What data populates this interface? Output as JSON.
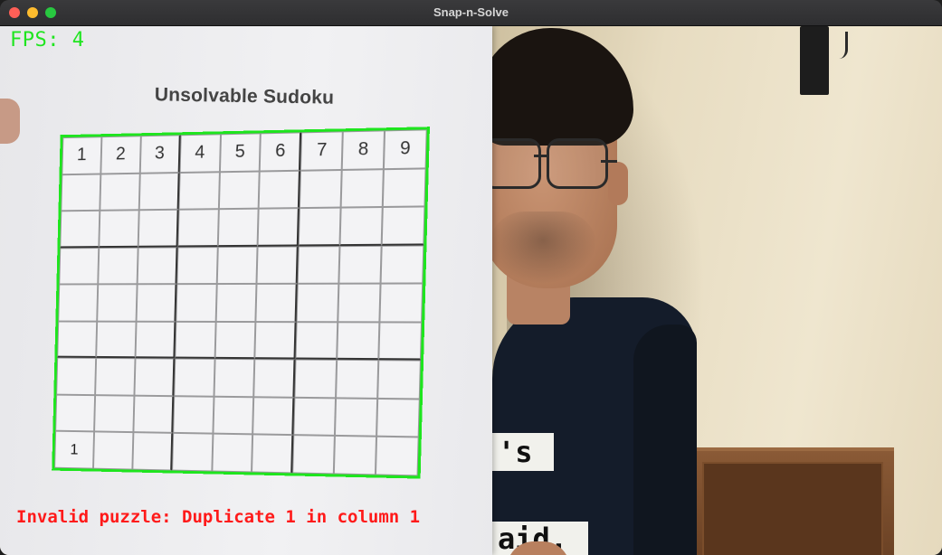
{
  "window": {
    "title": "Snap-n-Solve"
  },
  "overlay": {
    "fps_text": "FPS: 4",
    "error_text": "Invalid puzzle: Duplicate 1 in column 1"
  },
  "sudoku": {
    "title": "Unsolvable Sudoku",
    "rows": [
      [
        "1",
        "2",
        "3",
        "4",
        "5",
        "6",
        "7",
        "8",
        "9"
      ],
      [
        "",
        "",
        "",
        "",
        "",
        "",
        "",
        "",
        ""
      ],
      [
        "",
        "",
        "",
        "",
        "",
        "",
        "",
        "",
        ""
      ],
      [
        "",
        "",
        "",
        "",
        "",
        "",
        "",
        "",
        ""
      ],
      [
        "",
        "",
        "",
        "",
        "",
        "",
        "",
        "",
        ""
      ],
      [
        "",
        "",
        "",
        "",
        "",
        "",
        "",
        "",
        ""
      ],
      [
        "",
        "",
        "",
        "",
        "",
        "",
        "",
        "",
        ""
      ],
      [
        "",
        "",
        "",
        "",
        "",
        "",
        "",
        "",
        ""
      ],
      [
        "1",
        "",
        "",
        "",
        "",
        "",
        "",
        "",
        ""
      ]
    ]
  },
  "shirt_print": {
    "line1": "'s",
    "line2": "aid."
  },
  "colors": {
    "overlay_green": "#1fe51f",
    "error_red": "#ff1a1a",
    "traffic_close": "#ff5f57",
    "traffic_min": "#febc2e",
    "traffic_max": "#28c840"
  }
}
